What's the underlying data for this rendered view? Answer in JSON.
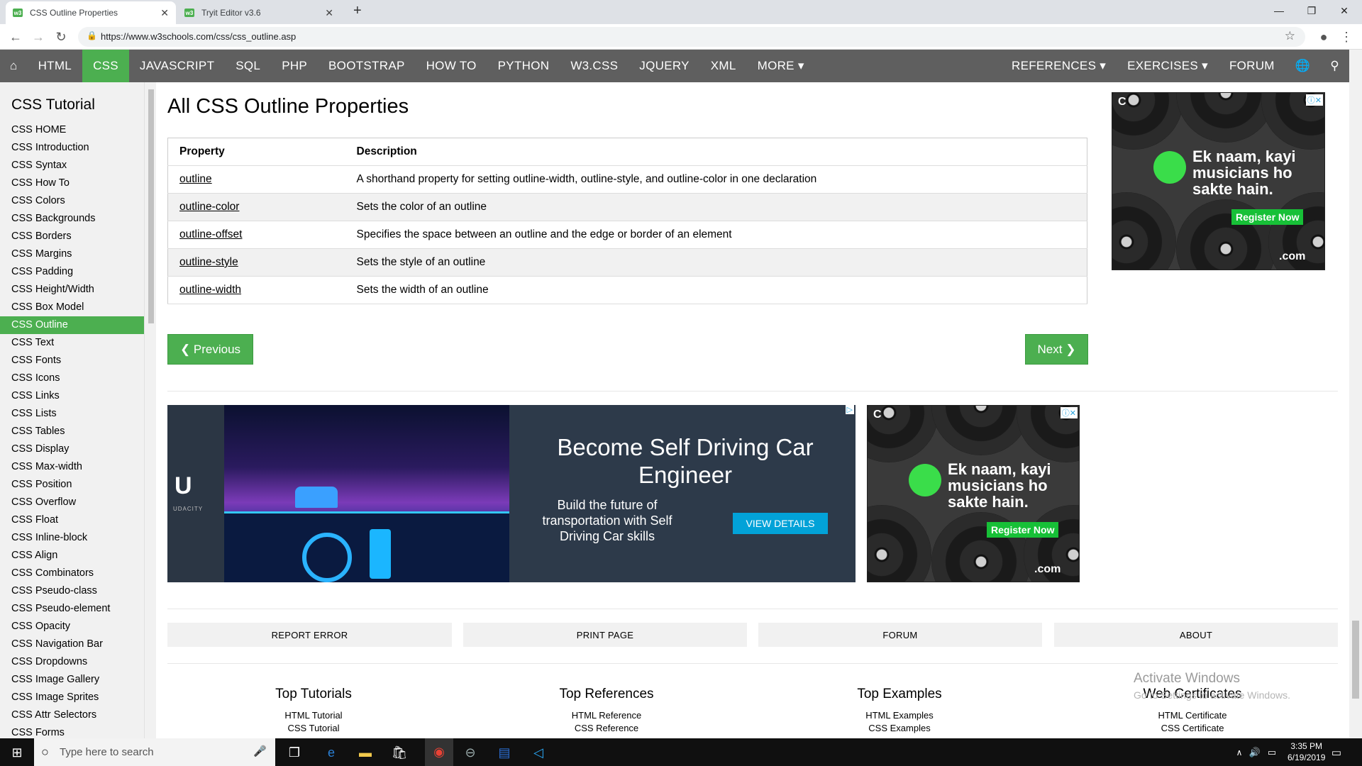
{
  "browser": {
    "tabs": [
      {
        "title": "CSS Outline Properties",
        "close": "✕"
      },
      {
        "title": "Tryit Editor v3.6",
        "close": "✕"
      }
    ],
    "new_tab": "+",
    "url": "https://www.w3schools.com/css/css_outline.asp",
    "window": {
      "min": "—",
      "max": "❐",
      "close": "✕"
    }
  },
  "topnav": {
    "items": [
      "HTML",
      "CSS",
      "JAVASCRIPT",
      "SQL",
      "PHP",
      "BOOTSTRAP",
      "HOW TO",
      "PYTHON",
      "W3.CSS",
      "JQUERY",
      "XML",
      "MORE ▾"
    ],
    "right": [
      "REFERENCES ▾",
      "EXERCISES ▾",
      "FORUM"
    ],
    "active": "CSS"
  },
  "sidebar": {
    "title": "CSS Tutorial",
    "items": [
      "CSS HOME",
      "CSS Introduction",
      "CSS Syntax",
      "CSS How To",
      "CSS Colors",
      "CSS Backgrounds",
      "CSS Borders",
      "CSS Margins",
      "CSS Padding",
      "CSS Height/Width",
      "CSS Box Model",
      "CSS Outline",
      "CSS Text",
      "CSS Fonts",
      "CSS Icons",
      "CSS Links",
      "CSS Lists",
      "CSS Tables",
      "CSS Display",
      "CSS Max-width",
      "CSS Position",
      "CSS Overflow",
      "CSS Float",
      "CSS Inline-block",
      "CSS Align",
      "CSS Combinators",
      "CSS Pseudo-class",
      "CSS Pseudo-element",
      "CSS Opacity",
      "CSS Navigation Bar",
      "CSS Dropdowns",
      "CSS Image Gallery",
      "CSS Image Sprites",
      "CSS Attr Selectors",
      "CSS Forms"
    ],
    "active": "CSS Outline"
  },
  "main": {
    "heading": "All CSS Outline Properties",
    "table": {
      "headers": [
        "Property",
        "Description"
      ],
      "rows": [
        [
          "outline",
          "A shorthand property for setting outline-width, outline-style, and outline-color in one declaration"
        ],
        [
          "outline-color",
          "Sets the color of an outline"
        ],
        [
          "outline-offset",
          "Specifies the space between an outline and the edge or border of an element"
        ],
        [
          "outline-style",
          "Sets the style of an outline"
        ],
        [
          "outline-width",
          "Sets the width of an outline"
        ]
      ]
    },
    "prev": "❮ Previous",
    "next": "Next ❯"
  },
  "ads": {
    "vinyl": {
      "line1": "Ek naam, kayi",
      "line2": "musicians ho",
      "line3": "sakte hain.",
      "brand": ".com",
      "cta": "Register Now",
      "c": "C"
    },
    "udacity": {
      "brand": "UDACITY",
      "title": "Become Self Driving Car Engineer",
      "subtitle": "Build the future of transportation with Self Driving Car skills",
      "cta": "VIEW DETAILS"
    }
  },
  "footer": {
    "buttons": [
      "REPORT ERROR",
      "PRINT PAGE",
      "FORUM",
      "ABOUT"
    ],
    "columns": [
      {
        "title": "Top Tutorials",
        "links": [
          "HTML Tutorial",
          "CSS Tutorial"
        ]
      },
      {
        "title": "Top References",
        "links": [
          "HTML Reference",
          "CSS Reference"
        ]
      },
      {
        "title": "Top Examples",
        "links": [
          "HTML Examples",
          "CSS Examples"
        ]
      },
      {
        "title": "Web Certificates",
        "links": [
          "HTML Certificate",
          "CSS Certificate"
        ]
      }
    ],
    "watermark": "Activate Windows",
    "watermark_sub": "Go to Settings to activate Windows."
  },
  "taskbar": {
    "search_placeholder": "Type here to search",
    "time": "3:35 PM",
    "date": "6/19/2019"
  },
  "colors": {
    "accent": "#4caf50",
    "nav": "#5f5f5f",
    "sidebar": "#f1f1f1"
  }
}
